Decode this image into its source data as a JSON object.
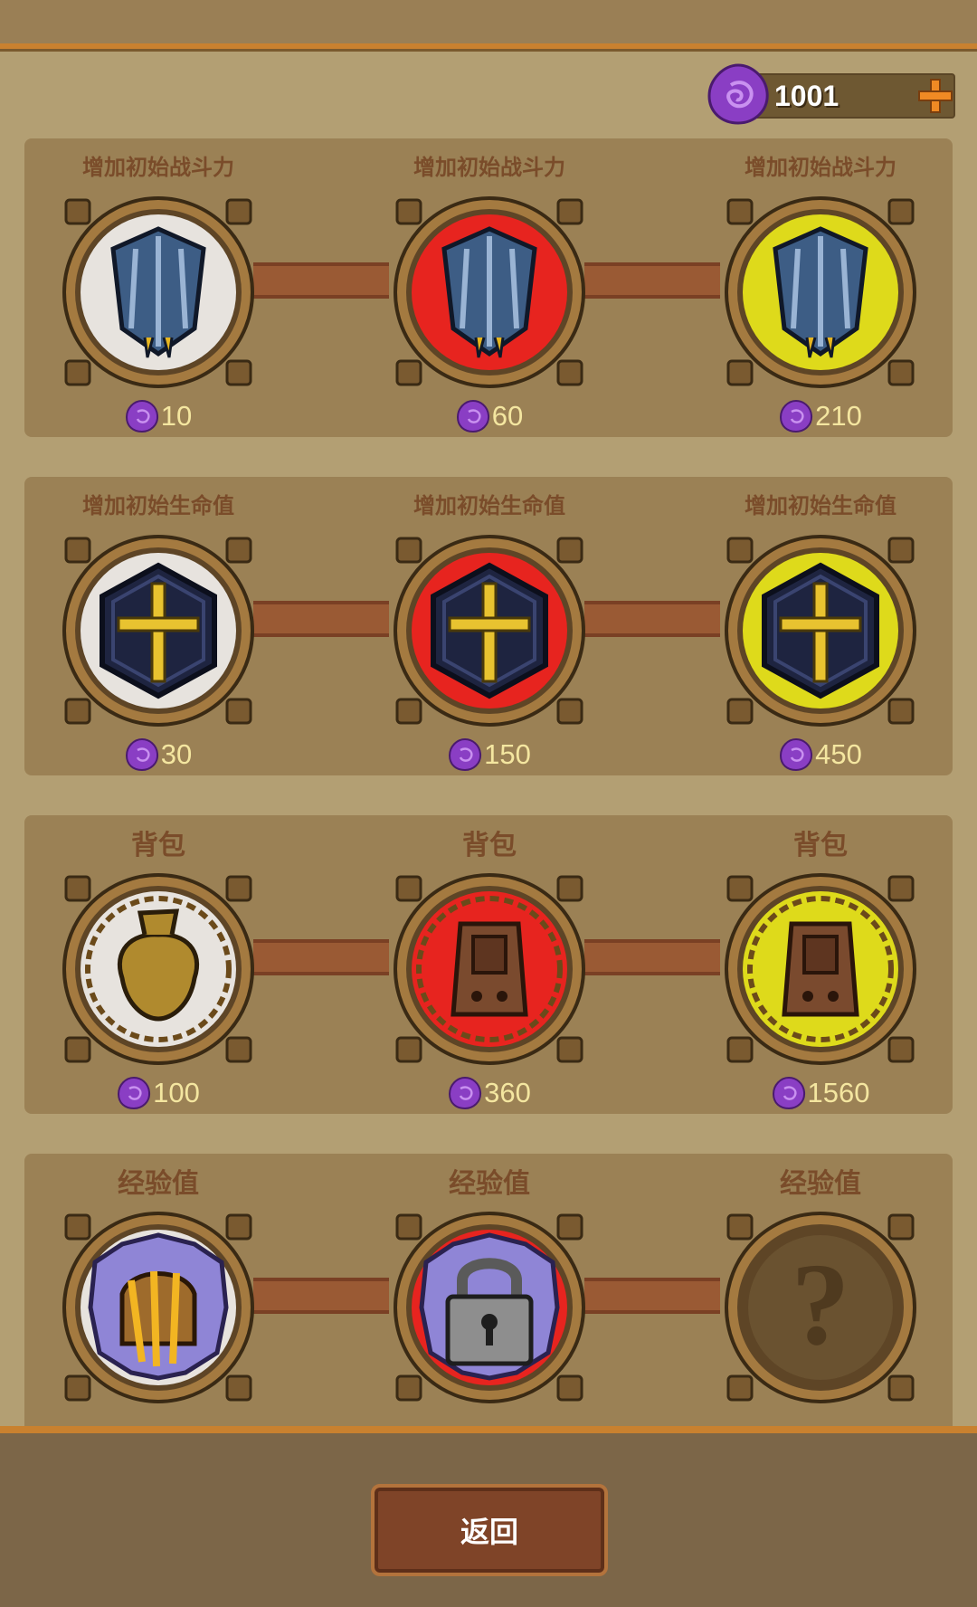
{
  "currency": {
    "amount": "1001",
    "add_label": "+"
  },
  "rows": [
    {
      "items": [
        {
          "title": "增加初始战斗力",
          "price": "10",
          "tier": "white",
          "icon": "shield-icon"
        },
        {
          "title": "增加初始战斗力",
          "price": "60",
          "tier": "red",
          "icon": "shield-icon"
        },
        {
          "title": "增加初始战斗力",
          "price": "210",
          "tier": "yellow",
          "icon": "shield-icon"
        }
      ]
    },
    {
      "items": [
        {
          "title": "增加初始生命值",
          "price": "30",
          "tier": "white",
          "icon": "cross-shield-icon"
        },
        {
          "title": "增加初始生命值",
          "price": "150",
          "tier": "red",
          "icon": "cross-shield-icon"
        },
        {
          "title": "增加初始生命值",
          "price": "450",
          "tier": "yellow",
          "icon": "cross-shield-icon"
        }
      ]
    },
    {
      "items": [
        {
          "title": "背包",
          "price": "100",
          "tier": "white",
          "icon": "bag-icon"
        },
        {
          "title": "背包",
          "price": "360",
          "tier": "red",
          "icon": "backpack-icon"
        },
        {
          "title": "背包",
          "price": "1560",
          "tier": "yellow",
          "icon": "backpack-icon"
        }
      ]
    },
    {
      "items": [
        {
          "title": "经验值",
          "price": "",
          "tier": "white",
          "icon": "treasure-chest-icon"
        },
        {
          "title": "经验值",
          "price": "",
          "tier": "red",
          "icon": "padlock-icon"
        },
        {
          "title": "经验值",
          "price": "",
          "tier": "none",
          "icon": "question-mark-icon"
        }
      ]
    }
  ],
  "footer": {
    "back_label": "返回"
  }
}
